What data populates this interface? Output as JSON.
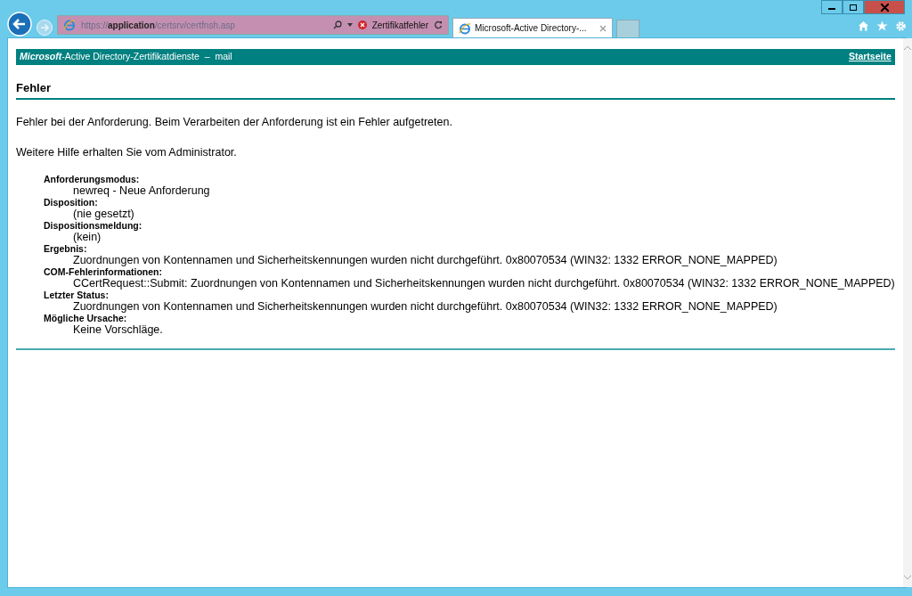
{
  "address_bar": {
    "url": {
      "scheme": "https://",
      "host": "application",
      "path": "/certsrv/certfnsh.asp"
    },
    "certificate_error": true,
    "error_label": "Zertifikatfehler"
  },
  "tabs": [
    {
      "label": "Microsoft-Active Directory-...",
      "selected": true
    }
  ],
  "header": {
    "title": "**Microsoft**-Active Directory-Zertifikatdienste  –  mail",
    "home_link": "Startseite"
  },
  "page": {
    "heading": "Fehler",
    "paragraphs": [
      "Fehler bei der Anforderung. Beim Verarbeiten der Anforderung ist ein Fehler aufgetreten.",
      "Weitere Hilfe erhalten Sie vom Administrator."
    ],
    "details": [
      {
        "label": "Anforderungsmodus:",
        "value": "newreq - Neue Anforderung"
      },
      {
        "label": "Disposition:",
        "value": "(nie gesetzt)"
      },
      {
        "label": "Dispositionsmeldung:",
        "value": "(kein)"
      },
      {
        "label": "Ergebnis:",
        "value": "Zuordnungen von Kontennamen und Sicherheitskennungen wurden nicht durchgeführt. 0x80070534 (WIN32: 1332 ERROR_NONE_MAPPED)"
      },
      {
        "label": "COM-Fehlerinformationen:",
        "value": "CCertRequest::Submit: Zuordnungen von Kontennamen und Sicherheitskennungen wurden nicht durchgeführt. 0x80070534 (WIN32: 1332 ERROR_NONE_MAPPED)"
      },
      {
        "label": "Letzter Status:",
        "value": "Zuordnungen von Kontennamen und Sicherheitskennungen wurden nicht durchgeführt. 0x80070534 (WIN32: 1332 ERROR_NONE_MAPPED)"
      },
      {
        "label": "Mögliche Ursache:",
        "value": "Keine Vorschläge."
      }
    ]
  }
}
